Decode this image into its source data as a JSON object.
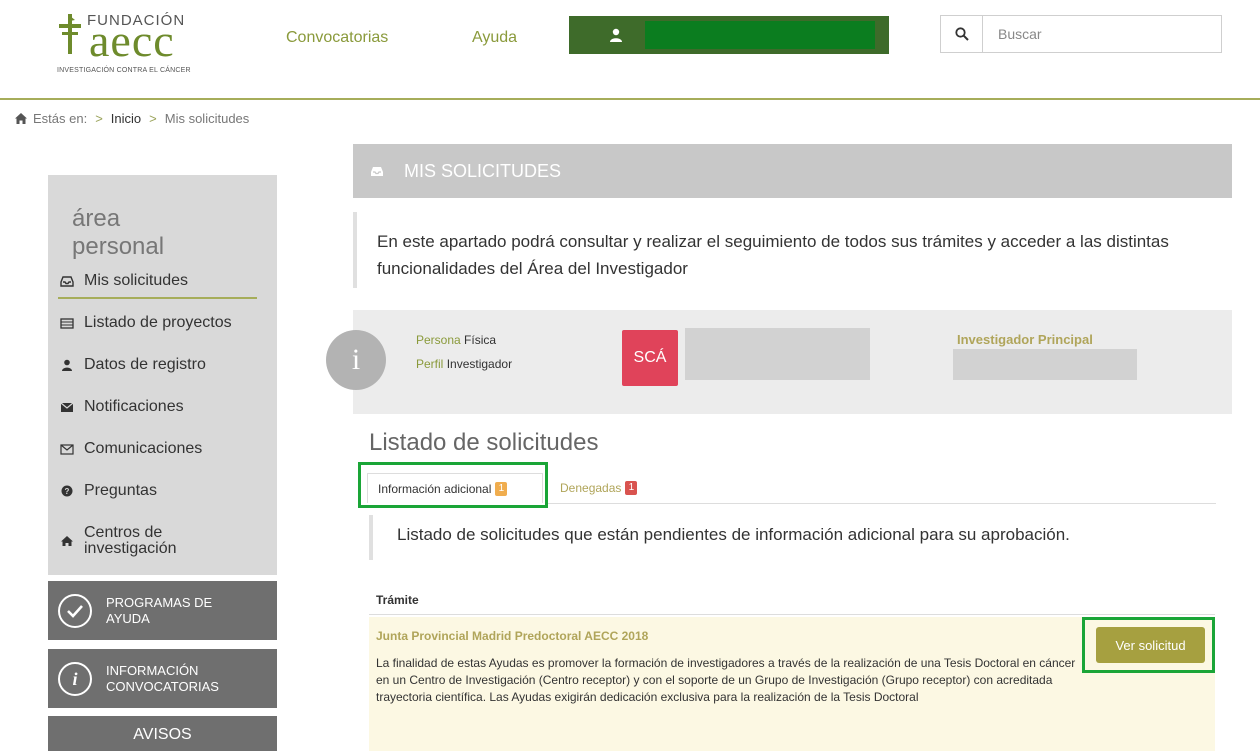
{
  "header": {
    "logo": {
      "fundacion": "FUNDACIÓN",
      "aecc": "aecc",
      "tagline": "INVESTIGACIÓN CONTRA EL CÁNCER"
    },
    "nav": [
      "Convocatorias",
      "Ayuda"
    ],
    "search_placeholder": "Buscar"
  },
  "breadcrumb": {
    "prefix": "Estás en:",
    "items": [
      "Inicio",
      "Mis solicitudes"
    ],
    "separator": ">"
  },
  "sidebar": {
    "title_line1": "área",
    "title_line2": "personal",
    "items": [
      {
        "label": "Mis solicitudes",
        "icon": "inbox-icon"
      },
      {
        "label": "Listado de proyectos",
        "icon": "list-icon"
      },
      {
        "label": "Datos de registro",
        "icon": "user-icon"
      },
      {
        "label": "Notificaciones",
        "icon": "envelope-icon"
      },
      {
        "label": "Comunicaciones",
        "icon": "envelope-outline-icon"
      },
      {
        "label": "Preguntas",
        "icon": "question-icon"
      },
      {
        "label_line1": "Centros de",
        "label_line2": "investigación",
        "icon": "home-icon"
      }
    ],
    "buttons": [
      {
        "line1": "PROGRAMAS DE",
        "line2": "AYUDA",
        "icon": "check-circle-icon"
      },
      {
        "line1": "INFORMACIÓN",
        "line2": "CONVOCATORIAS",
        "icon": "info-circle-icon"
      }
    ],
    "avisos": "AVISOS"
  },
  "main": {
    "panel_title": "MIS SOLICITUDES",
    "intro": "En este apartado podrá consultar y realizar el seguimiento de todos sus trámites y acceder a las distintas funcionalidades del Área del Investigador",
    "profile": {
      "info_glyph": "i",
      "persona_label": "Persona",
      "persona_value": "Física",
      "perfil_label": "Perfil",
      "perfil_value": "Investigador",
      "badge": "SCÁ",
      "role": "Investigador Principal"
    },
    "list_title": "Listado de solicitudes",
    "tabs": [
      {
        "label": "Información adicional",
        "count": "1"
      },
      {
        "label": "Denegadas",
        "count": "1"
      }
    ],
    "list_desc": "Listado de solicitudes que están pendientes de información adicional para su aprobación.",
    "table": {
      "header": "Trámite",
      "rows": [
        {
          "title": "Junta Provincial Madrid Predoctoral AECC 2018",
          "desc": "La finalidad de estas Ayudas es promover la formación de investigadores a través de la realización de una Tesis Doctoral en cáncer en un Centro de Investigación (Centro receptor) y con el soporte de un Grupo de Investigación (Grupo receptor) con acreditada trayectoria científica. Las Ayudas exigirán dedicación exclusiva para la realización de la Tesis Doctoral",
          "button": "Ver solicitud"
        }
      ]
    }
  },
  "colors": {
    "brand_green": "#6e8b2c",
    "olive_link": "#8a9a3b",
    "highlight_green": "#1aa537",
    "button_olive": "#a6a040",
    "badge_red": "#e0435a"
  }
}
